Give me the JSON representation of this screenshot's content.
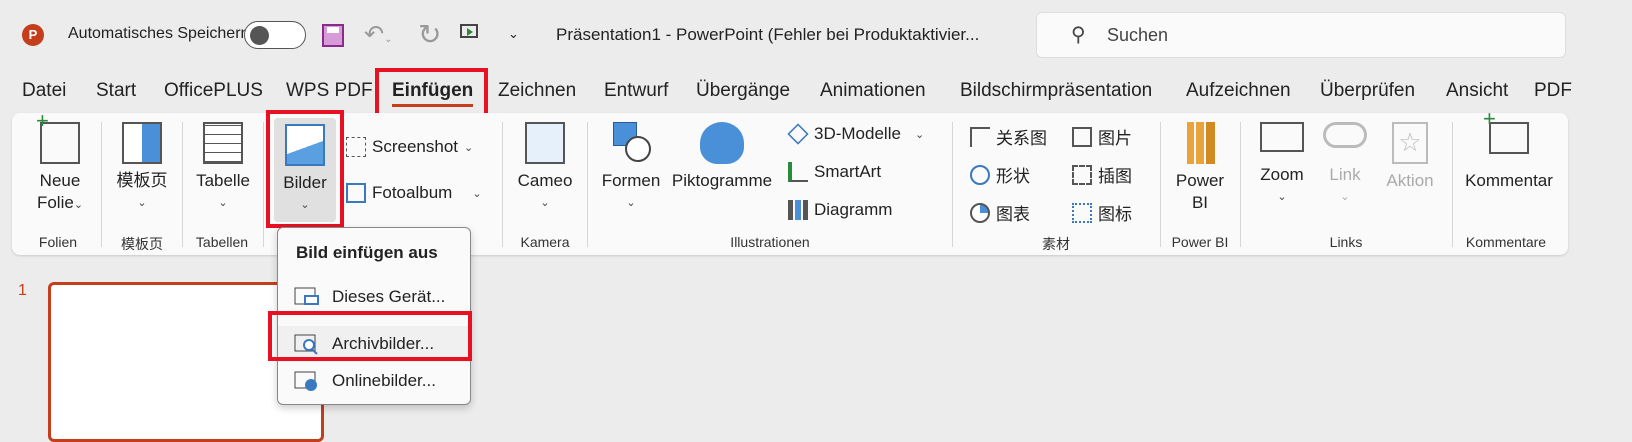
{
  "titlebar": {
    "autosave_label": "Automatisches Speichern",
    "autosave_on": false,
    "doc_title": "Präsentation1  -  PowerPoint (Fehler bei Produktaktivier...",
    "search_placeholder": "Suchen"
  },
  "tabs": [
    "Datei",
    "Start",
    "OfficePLUS",
    "WPS PDF",
    "Einfügen",
    "Zeichnen",
    "Entwurf",
    "Übergänge",
    "Animationen",
    "Bildschirmpräsentation",
    "Aufzeichnen",
    "Überprüfen",
    "Ansicht",
    "PDF"
  ],
  "active_tab": "Einfügen",
  "ribbon": {
    "neue_folie": [
      "Neue",
      "Folie"
    ],
    "folien_group": "Folien",
    "template": "模板页",
    "template_group": "模板页",
    "tabelle": "Tabelle",
    "tabellen_group": "Tabellen",
    "bilder": "Bilder",
    "screenshot": "Screenshot",
    "fotoalbum": "Fotoalbum",
    "cameo": "Cameo",
    "kamera_group": "Kamera",
    "formen": "Formen",
    "piktogramme": "Piktogramme",
    "modelle": "3D-Modelle",
    "smartart": "SmartArt",
    "diagramm": "Diagramm",
    "illustrationen_group": "Illustrationen",
    "sucai": [
      "关系图",
      "图片",
      "形状",
      "插图",
      "图表",
      "图标"
    ],
    "sucai_group": "素材",
    "powerbi": [
      "Power",
      "BI"
    ],
    "powerbi_group": "Power BI",
    "zoom": "Zoom",
    "link": "Link",
    "aktion": "Aktion",
    "links_group": "Links",
    "kommentar": "Kommentar",
    "kommentare_group": "Kommentare"
  },
  "menu": {
    "header": "Bild einfügen aus",
    "items": [
      "Dieses Gerät...",
      "Archivbilder...",
      "Onlinebilder..."
    ]
  },
  "slides": {
    "number": "1"
  },
  "colors": {
    "accent": "#c43e1c",
    "highlight": "#e81123"
  }
}
